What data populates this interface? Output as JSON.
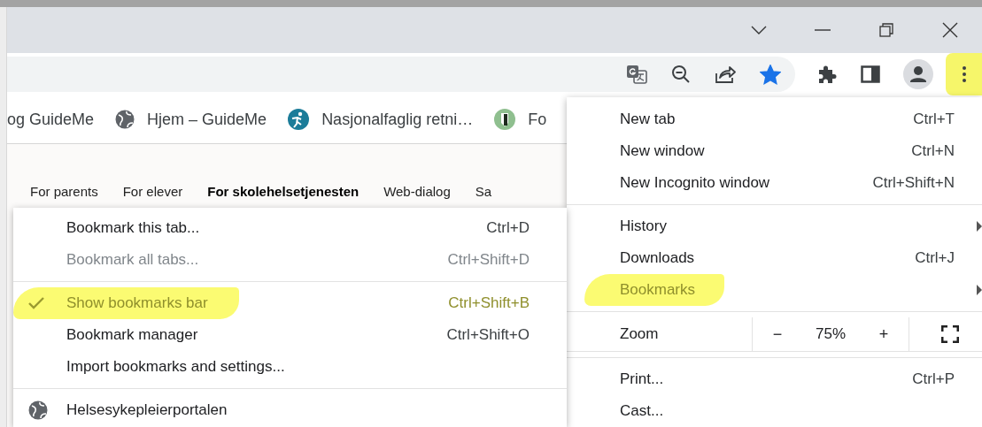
{
  "toolbar": {
    "menu_button_highlighted": true,
    "bookmark_starred": true
  },
  "bookmarks_bar": [
    {
      "label": "og GuideMe"
    },
    {
      "label": "Hjem – GuideMe"
    },
    {
      "label": "Nasjonalfaglig retni…"
    },
    {
      "label": "Fo"
    }
  ],
  "page": {
    "nav": [
      {
        "label": "For parents",
        "bold": false
      },
      {
        "label": "For elever",
        "bold": false
      },
      {
        "label": "For skolehelsetjenesten",
        "bold": true
      },
      {
        "label": "Web-dialog",
        "bold": false
      },
      {
        "label": "Sa",
        "bold": false
      }
    ]
  },
  "main_menu": [
    {
      "kind": "item",
      "label": "New tab",
      "shortcut": "Ctrl+T",
      "submenu": false,
      "highlighted": false
    },
    {
      "kind": "item",
      "label": "New window",
      "shortcut": "Ctrl+N",
      "submenu": false,
      "highlighted": false
    },
    {
      "kind": "item",
      "label": "New Incognito window",
      "shortcut": "Ctrl+Shift+N",
      "submenu": false,
      "highlighted": false
    },
    {
      "kind": "separator"
    },
    {
      "kind": "item",
      "label": "History",
      "submenu": true,
      "highlighted": false
    },
    {
      "kind": "item",
      "label": "Downloads",
      "shortcut": "Ctrl+J",
      "submenu": false,
      "highlighted": false
    },
    {
      "kind": "item",
      "label": "Bookmarks",
      "submenu": true,
      "highlighted": true
    },
    {
      "kind": "separator"
    },
    {
      "kind": "zoom",
      "label": "Zoom",
      "minus": "−",
      "value": "75%",
      "plus": "+"
    },
    {
      "kind": "separator"
    },
    {
      "kind": "item",
      "label": "Print...",
      "shortcut": "Ctrl+P",
      "submenu": false,
      "highlighted": false
    },
    {
      "kind": "item",
      "label": "Cast...",
      "submenu": false,
      "highlighted": false
    }
  ],
  "bookmarks_menu": [
    {
      "kind": "item",
      "label": "Bookmark this tab...",
      "shortcut": "Ctrl+D",
      "checked": false,
      "disabled": false,
      "highlighted": false
    },
    {
      "kind": "item",
      "label": "Bookmark all tabs...",
      "shortcut": "Ctrl+Shift+D",
      "checked": false,
      "disabled": true,
      "highlighted": false
    },
    {
      "kind": "separator"
    },
    {
      "kind": "item",
      "label": "Show bookmarks bar",
      "shortcut": "Ctrl+Shift+B",
      "checked": true,
      "disabled": false,
      "highlighted": true
    },
    {
      "kind": "item",
      "label": "Bookmark manager",
      "shortcut": "Ctrl+Shift+O",
      "checked": false,
      "disabled": false,
      "highlighted": false
    },
    {
      "kind": "item",
      "label": "Import bookmarks and settings...",
      "checked": false,
      "disabled": false,
      "highlighted": false
    },
    {
      "kind": "separator"
    },
    {
      "kind": "bookmark",
      "label": "Helsesykepleierportalen"
    }
  ]
}
